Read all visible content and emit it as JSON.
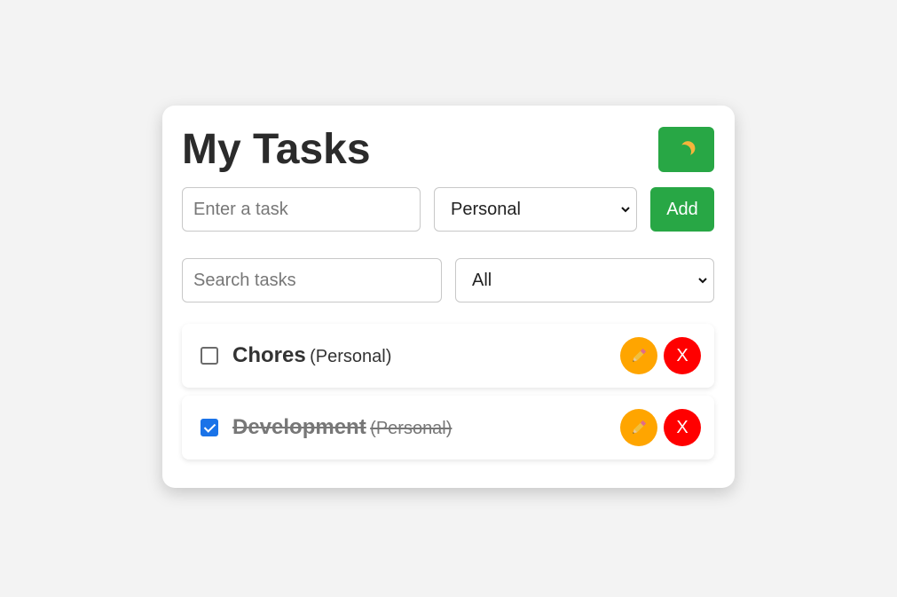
{
  "app": {
    "title": "My Tasks",
    "theme_toggle_icon": "moon-icon"
  },
  "form": {
    "task_placeholder": "Enter a task",
    "category_selected": "Personal",
    "add_label": "Add"
  },
  "filters": {
    "search_placeholder": "Search tasks",
    "filter_selected": "All"
  },
  "tasks": [
    {
      "name": "Chores",
      "category": "(Personal)",
      "completed": false,
      "delete_label": "X"
    },
    {
      "name": "Development",
      "category": "(Personal)",
      "completed": true,
      "delete_label": "X"
    }
  ],
  "colors": {
    "accent_green": "#28a745",
    "edit_orange": "#ffa500",
    "delete_red": "#ff0000",
    "checkbox_blue": "#1a73e8"
  }
}
